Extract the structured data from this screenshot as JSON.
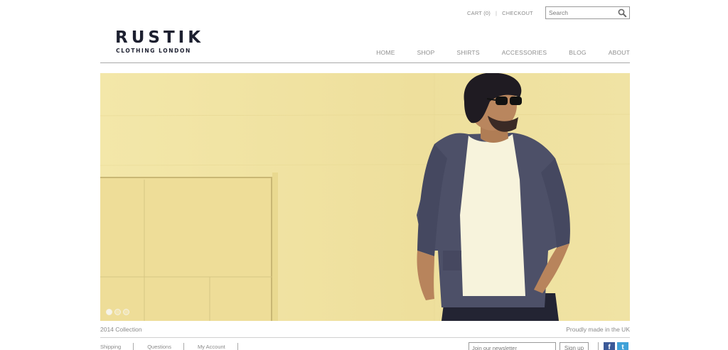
{
  "header": {
    "cart_label": "CART (0)",
    "separator": "|",
    "checkout_label": "CHECKOUT",
    "search_placeholder": "Search",
    "search_icon": "magnifier-icon"
  },
  "logo": {
    "brand": "RUSTIK",
    "tagline": "CLOTHING LONDON"
  },
  "nav": {
    "items": [
      "HOME",
      "SHOP",
      "SHIRTS",
      "ACCESSORIES",
      "BLOG",
      "ABOUT"
    ]
  },
  "hero": {
    "slides": 3,
    "active_slide": 1,
    "tone_color": "#efe3a6"
  },
  "caption": {
    "left": "2014 Collection",
    "right": "Proudly made in the UK"
  },
  "footer": {
    "links": [
      "Shipping",
      "Questions",
      "My Account"
    ],
    "newsletter_placeholder": "Join our newsletter",
    "signup_label": "Sign up",
    "social": [
      {
        "name": "facebook-icon",
        "glyph": "f",
        "color": "#3b5998"
      },
      {
        "name": "twitter-icon",
        "glyph": "t",
        "color": "#3fa1d8"
      }
    ]
  }
}
